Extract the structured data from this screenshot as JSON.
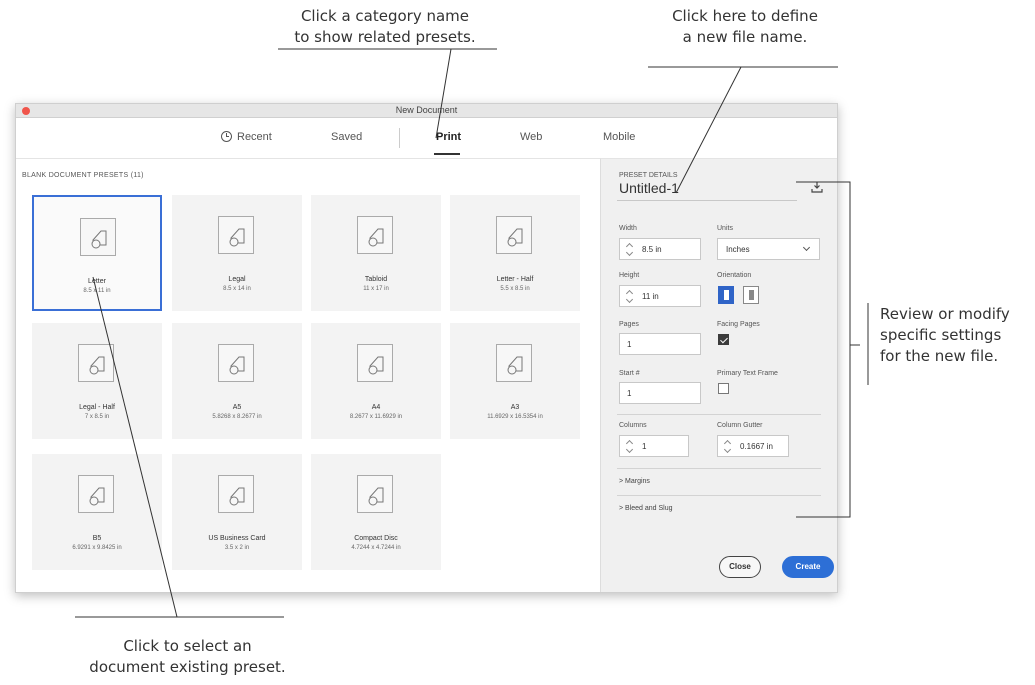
{
  "callouts": {
    "category": [
      "Click a category name",
      "to show related presets."
    ],
    "filename": [
      "Click here to define",
      "a new file name."
    ],
    "review": [
      "Review or modify",
      "specific settings",
      "for the new file."
    ],
    "select": [
      "Click to select an",
      "document existing preset."
    ]
  },
  "window": {
    "title": "New Document",
    "tabs": [
      "Recent",
      "Saved",
      "Print",
      "Web",
      "Mobile"
    ],
    "active_tab": "Print"
  },
  "presets": {
    "title": "BLANK DOCUMENT PRESETS",
    "count": "(11)",
    "items": [
      {
        "name": "Letter",
        "size": "8.5 x 11 in"
      },
      {
        "name": "Legal",
        "size": "8.5 x 14 in"
      },
      {
        "name": "Tabloid",
        "size": "11 x 17 in"
      },
      {
        "name": "Letter - Half",
        "size": "5.5 x 8.5 in"
      },
      {
        "name": "Legal - Half",
        "size": "7 x 8.5 in"
      },
      {
        "name": "A5",
        "size": "5.8268 x 8.2677 in"
      },
      {
        "name": "A4",
        "size": "8.2677 x 11.6929 in"
      },
      {
        "name": "A3",
        "size": "11.6929 x 16.5354 in"
      },
      {
        "name": "B5",
        "size": "6.9291 x 9.8425 in"
      },
      {
        "name": "US Business Card",
        "size": "3.5 x 2 in"
      },
      {
        "name": "Compact Disc",
        "size": "4.7244 x 4.7244 in"
      }
    ]
  },
  "details": {
    "title": "PRESET DETAILS",
    "doc_name": "Untitled-1",
    "width_label": "Width",
    "width": "8.5 in",
    "units_label": "Units",
    "units": "Inches",
    "height_label": "Height",
    "height": "11 in",
    "orientation_label": "Orientation",
    "pages_label": "Pages",
    "pages": "1",
    "facing_label": "Facing Pages",
    "start_label": "Start #",
    "start": "1",
    "ptf_label": "Primary Text Frame",
    "columns_label": "Columns",
    "columns": "1",
    "gutter_label": "Column Gutter",
    "gutter": "0.1667 in",
    "margins": "> Margins",
    "bleed": "> Bleed and Slug",
    "close": "Close",
    "create": "Create"
  },
  "colors": {
    "accent": "#2d6fd6",
    "selected_border": "#3a6fd6"
  }
}
